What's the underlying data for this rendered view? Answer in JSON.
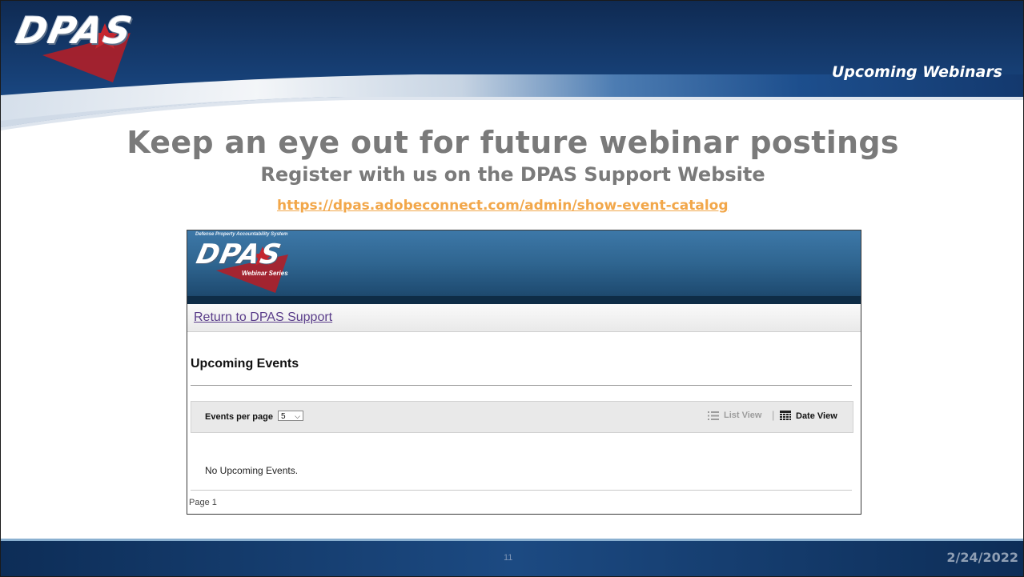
{
  "header": {
    "logo_text": "DPAS",
    "section_title": "Upcoming Webinars"
  },
  "content": {
    "headline": "Keep an eye out for future webinar postings",
    "subhead": "Register with us on the DPAS Support Website",
    "url": "https://dpas.adobeconnect.com/admin/show-event-catalog"
  },
  "screenshot": {
    "tagline": "Defense Property Accountability System",
    "logo_text": "DPAS",
    "logo_subtitle": "Webinar Series",
    "return_link": "Return to DPAS Support",
    "heading": "Upcoming Events",
    "events_per_page_label": "Events per page",
    "events_per_page_value": "5",
    "list_view_label": "List View",
    "divider": "|",
    "date_view_label": "Date View",
    "empty_message": "No Upcoming Events.",
    "page_label": "Page 1"
  },
  "footer": {
    "slide_number": "11",
    "date": "2/24/2022"
  },
  "colors": {
    "brand_navy": "#0d2d57",
    "heading_gray": "#7a7a7a",
    "link_orange": "#f2a74a",
    "link_purple": "#5a3d8a",
    "logo_red": "#b01f28"
  }
}
